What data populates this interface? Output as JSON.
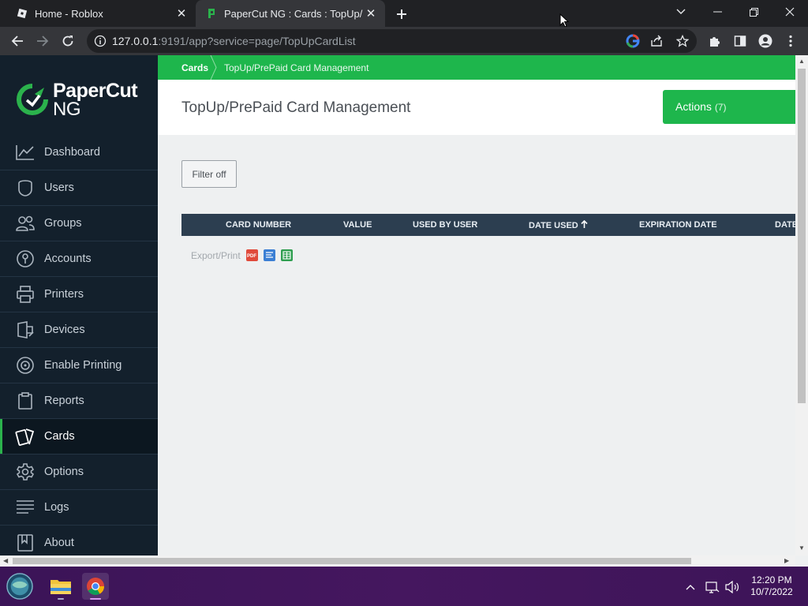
{
  "browser": {
    "tabs": [
      {
        "title": "Home - Roblox",
        "active": false
      },
      {
        "title": "PaperCut NG : Cards : TopUp/Pre",
        "active": true
      }
    ],
    "url_host": "127.0.0.1",
    "url_rest": ":9191/app?service=page/TopUpCardList"
  },
  "app": {
    "logo_brand": "PaperCut",
    "logo_sub": "NG",
    "nav": [
      {
        "label": "Dashboard",
        "icon": "chart-line-icon"
      },
      {
        "label": "Users",
        "icon": "user-icon"
      },
      {
        "label": "Groups",
        "icon": "group-icon"
      },
      {
        "label": "Accounts",
        "icon": "account-icon"
      },
      {
        "label": "Printers",
        "icon": "printer-icon"
      },
      {
        "label": "Devices",
        "icon": "device-icon"
      },
      {
        "label": "Enable Printing",
        "icon": "target-icon"
      },
      {
        "label": "Reports",
        "icon": "clipboard-icon"
      },
      {
        "label": "Cards",
        "icon": "cards-icon",
        "active": true
      },
      {
        "label": "Options",
        "icon": "gear-icon"
      },
      {
        "label": "Logs",
        "icon": "list-icon"
      },
      {
        "label": "About",
        "icon": "bookmark-icon"
      }
    ],
    "breadcrumb": {
      "root": "Cards",
      "current": "TopUp/PrePaid Card Management"
    },
    "page_title": "TopUp/PrePaid Card Management",
    "actions": {
      "label": "Actions",
      "count": "(7)"
    },
    "filter_button": "Filter off",
    "table": {
      "columns": [
        "CARD NUMBER",
        "VALUE",
        "USED BY USER",
        "DATE USED",
        "EXPIRATION DATE",
        "DATE"
      ],
      "sorted_column": "DATE USED"
    },
    "export": {
      "label": "Export/Print",
      "formats": [
        "PDF",
        "HTML",
        "CSV"
      ]
    }
  },
  "taskbar": {
    "time": "12:20 PM",
    "date": "10/7/2022"
  },
  "colors": {
    "accent_green": "#1eb64c",
    "sidebar_bg": "#13202c",
    "table_header": "#2c3e50"
  }
}
